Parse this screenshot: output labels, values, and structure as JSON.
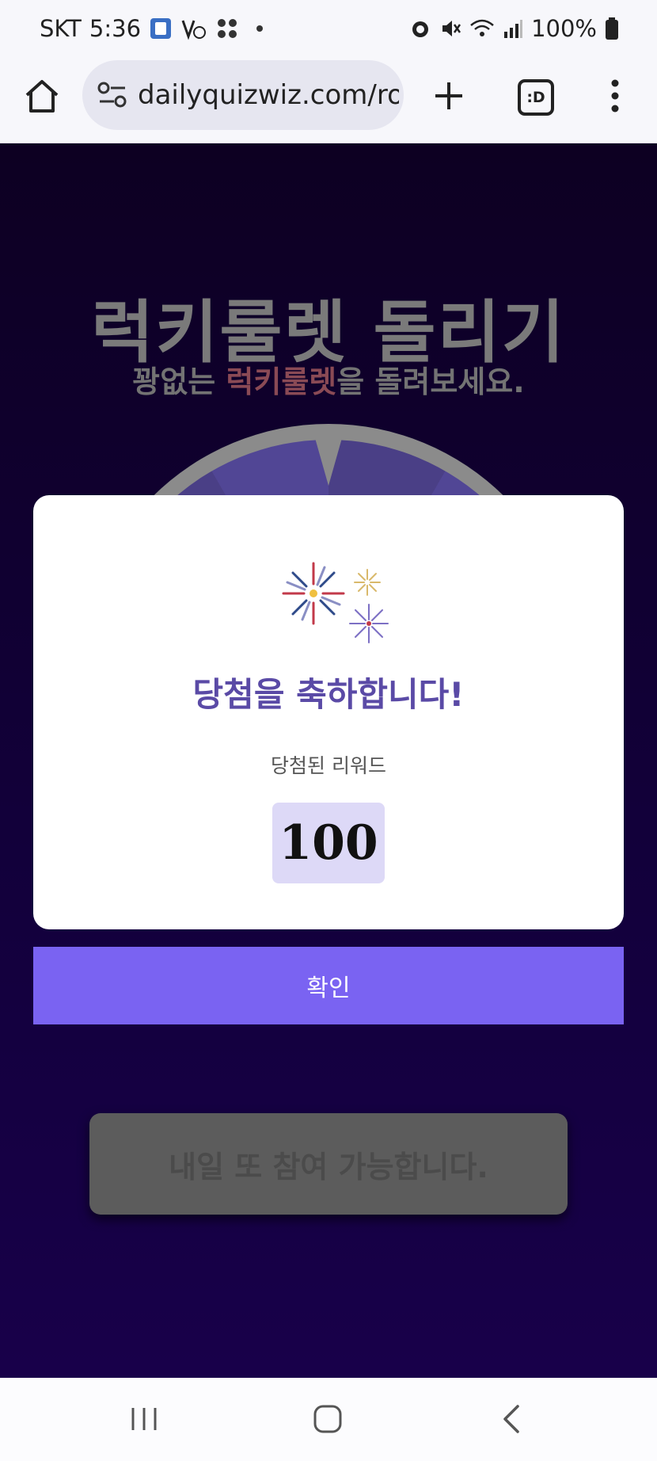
{
  "status_bar": {
    "carrier": "SKT",
    "time": "5:36",
    "battery": "100%"
  },
  "browser": {
    "url": "dailyquizwiz.com/ro",
    "tab_icon_text": ":D"
  },
  "page": {
    "title": "럭키룰렛 돌리기",
    "subtitle_prefix": "꽝없는 ",
    "subtitle_highlight": "럭키룰렛",
    "subtitle_suffix": "을 돌려보세요.",
    "tomorrow_button_label": "내일 또 참여 가능합니다."
  },
  "modal": {
    "title": "당첨을 축하합니다!",
    "reward_label": "당첨된 리워드",
    "reward_value": "100",
    "confirm_label": "확인"
  },
  "colors": {
    "accent": "#7a63f2",
    "modal_title": "#5a4aa6",
    "background": "#12003a"
  },
  "icons": {
    "status": [
      "sim-card-icon",
      "notification-icon",
      "grid-icon",
      "alarm-icon",
      "mute-icon",
      "wifi-icon",
      "signal-icon",
      "battery-icon"
    ],
    "browser": [
      "home-icon",
      "site-settings-icon",
      "plus-icon",
      "tabs-icon",
      "more-vert-icon"
    ],
    "nav": [
      "recent-apps-icon",
      "home-nav-icon",
      "back-icon"
    ]
  }
}
